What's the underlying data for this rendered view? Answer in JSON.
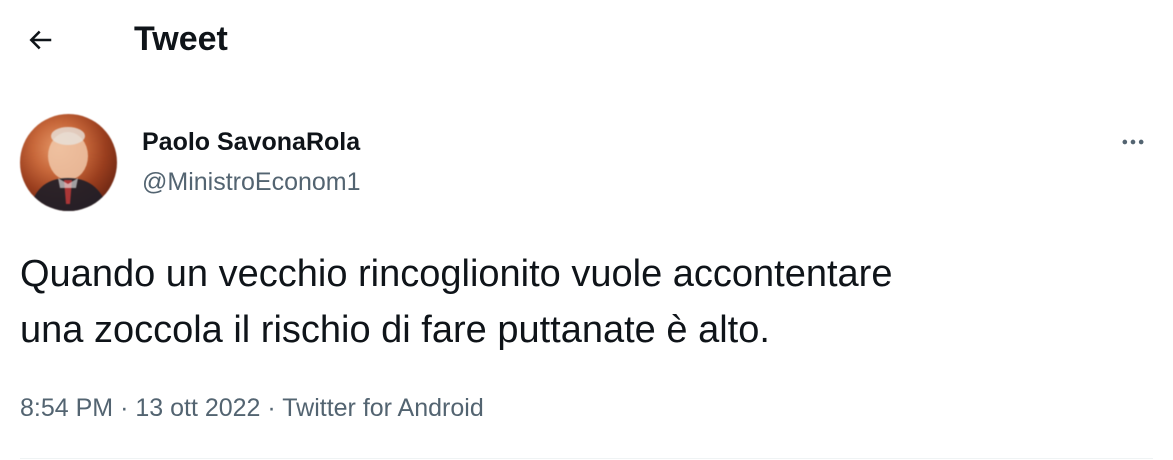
{
  "header": {
    "title": "Tweet",
    "back_icon": "arrow-left-icon"
  },
  "author": {
    "name": "Paolo SavonaRola",
    "handle": "@MinistroEconom1",
    "avatar_icon": "avatar-photo"
  },
  "tweet": {
    "text": "Quando un vecchio rincoglionito vuole accontentare\nuna zoccola il rischio di fare puttanate è alto.",
    "time": "8:54 PM",
    "date": "13 ott 2022",
    "source": "Twitter for Android",
    "separator": "·"
  },
  "actions": {
    "more_icon": "more-horizontal-icon"
  },
  "colors": {
    "text_primary": "#0f1419",
    "text_secondary": "#536471",
    "divider": "#eff3f4"
  }
}
